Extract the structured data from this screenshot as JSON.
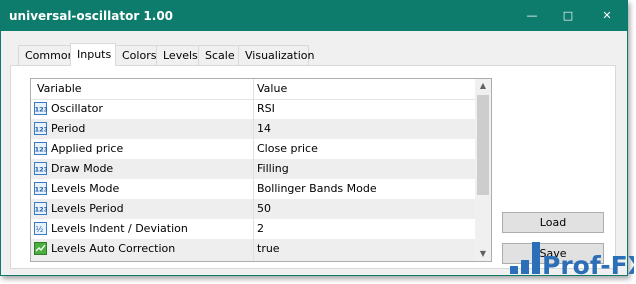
{
  "window": {
    "title": "universal-oscillator 1.00"
  },
  "title_buttons": {
    "minimize": "—",
    "maximize": "□",
    "close": "✕"
  },
  "tabs": [
    "Common",
    "Inputs",
    "Colors",
    "Levels",
    "Scale",
    "Visualization"
  ],
  "active_tab": "Inputs",
  "table": {
    "headers": {
      "variable": "Variable",
      "value": "Value"
    },
    "rows": [
      {
        "icon": "123-number-icon",
        "variable": "Oscillator",
        "value": "RSI"
      },
      {
        "icon": "123-number-icon",
        "variable": "Period",
        "value": "14"
      },
      {
        "icon": "123-number-icon",
        "variable": "Applied price",
        "value": "Close price"
      },
      {
        "icon": "123-number-icon",
        "variable": "Draw Mode",
        "value": "Filling"
      },
      {
        "icon": "123-number-icon",
        "variable": "Levels Mode",
        "value": "Bollinger Bands Mode"
      },
      {
        "icon": "123-number-icon",
        "variable": "Levels Period",
        "value": "50"
      },
      {
        "icon": "half-fraction-icon",
        "variable": "Levels Indent / Deviation",
        "value": "2"
      },
      {
        "icon": "chart-bool-icon",
        "variable": "Levels Auto Correction",
        "value": "true"
      }
    ]
  },
  "buttons": {
    "load": "Load",
    "save": "Save"
  },
  "watermark": "Prof-FX"
}
